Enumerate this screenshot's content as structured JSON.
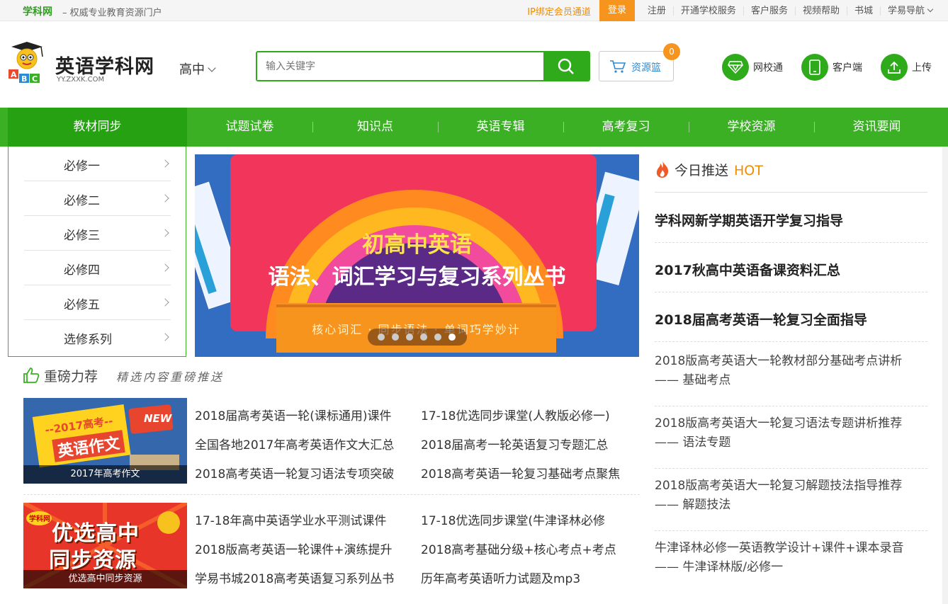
{
  "topbar": {
    "brand": "学科网",
    "slogan": "– 权威专业教育资源门户",
    "ip_link": "IP绑定会员通道",
    "login": "登录",
    "register": "注册",
    "school_service": "开通学校服务",
    "customer_service": "客户服务",
    "video_help": "视频帮助",
    "bookstore": "书城",
    "nav": "学易导航"
  },
  "header": {
    "logo_title": "英语学科网",
    "logo_url": "YY.ZXXK.COM",
    "grade": "高中",
    "search_placeholder": "输入关键字",
    "basket_label": "资源篮",
    "basket_count": "0",
    "school_net": "网校通",
    "client": "客户端",
    "upload": "上传"
  },
  "nav": {
    "items": [
      "教材同步",
      "试题试卷",
      "知识点",
      "英语专辑",
      "高考复习",
      "学校资源",
      "资讯要闻"
    ]
  },
  "sidebar": {
    "items": [
      "必修一",
      "必修二",
      "必修三",
      "必修四",
      "必修五",
      "选修系列"
    ]
  },
  "banner": {
    "title1": "初高中英语",
    "title2": "语法、词汇学习与复习系列丛书",
    "ribbon": "核心词汇 · 同步语法 · 单词巧学妙计",
    "active_dot": 6,
    "dot_count": 6
  },
  "hot": {
    "title": "今日推送",
    "tag": "HOT",
    "big": [
      "学科网新学期英语开学复习指导",
      "2017秋高中英语备课资料汇总",
      "2018届高考英语一轮复习全面指导"
    ],
    "small": [
      [
        "2018版高考英语大一轮教材部分基础考点讲析",
        "—— 基础考点"
      ],
      [
        "2018版高考英语大一轮复习语法专题讲析推荐",
        "—— 语法专题"
      ],
      [
        "2018版高考英语大一轮复习解题技法指导推荐",
        "—— 解题技法"
      ],
      [
        "牛津译林必修一英语教学设计+课件+课本录音",
        "—— 牛津译林版/必修一"
      ]
    ]
  },
  "recommend": {
    "title": "重磅力荐",
    "subtitle": "精选内容重磅推送",
    "block1": {
      "caption": "2017年高考作文",
      "art_top": "--2017高考--",
      "art_main": "英语作文",
      "art_new": "NEW",
      "links": [
        "2018届高考英语一轮(课标通用)课件",
        "17-18优选同步课堂(人教版必修一)",
        "全国各地2017年高考英语作文大汇总",
        "2018届高考一轮英语复习专题汇总",
        "2018高考英语一轮复习语法专项突破",
        "2018高考英语一轮复习基础考点聚焦"
      ]
    },
    "block2": {
      "caption": "优选高中同步资源",
      "art_brand": "学科网",
      "art_main1": "优选高中",
      "art_main2": "同步资源",
      "links": [
        "17-18年高中英语学业水平测试课件",
        "17-18优选同步课堂(牛津译林必修",
        "2018版高考英语一轮课件+演练提升",
        "2018高考基础分级+核心考点+考点",
        "学易书城2018高考英语复习系列丛书",
        "历年高考英语听力试题及mp3"
      ]
    }
  },
  "colors": {
    "green": "#3bb025",
    "dark_green": "#26a112",
    "orange": "#f7941d"
  }
}
